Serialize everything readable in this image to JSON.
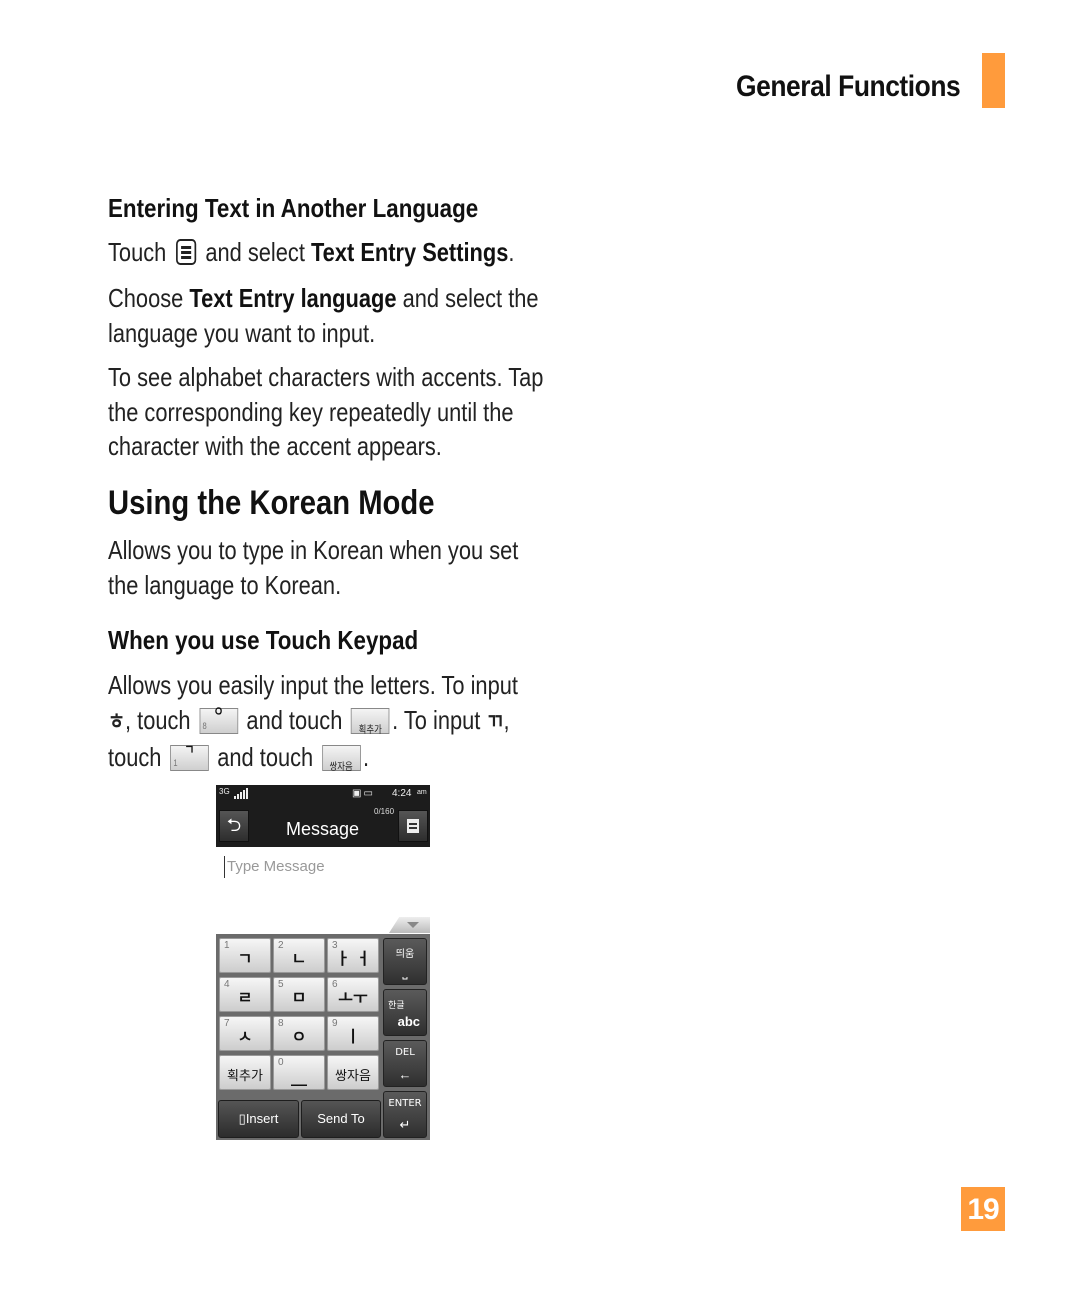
{
  "header": {
    "section_title": "General Functions",
    "accent_color": "#ff9b3c"
  },
  "entering_text": {
    "heading": "Entering Text in Another Language",
    "p1": {
      "before": "Touch",
      "icon": "menu-icon",
      "middle": "and select",
      "bold": "Text Entry Settings",
      "after": "."
    },
    "p2": {
      "before": "Choose",
      "bold": "Text Entry language",
      "after_line1": "and select the",
      "line2": "language you want to input."
    },
    "p3": {
      "line1": "To see alphabet characters with accents. Tap",
      "line2": "the corresponding key repeatedly until the",
      "line3": "character with the accent appears."
    }
  },
  "korean_mode": {
    "heading": "Using the Korean Mode",
    "intro_line1": "Allows you to type in Korean when you set",
    "intro_line2": "the language to Korean.",
    "subheading": "When you use Touch Keypad",
    "body_line1": "Allows you easily input the letters. To input",
    "char_h": "ㅎ",
    "touch_1": ", touch",
    "key_o": {
      "num": "8",
      "glyph": "ㅇ"
    },
    "and_touch": "and touch",
    "key_stroke": "획추가",
    "to_input": ". To input",
    "char_kk": "ㄲ",
    "comma": ",",
    "touch_2": "touch",
    "key_g": {
      "num": "1",
      "glyph": "ㄱ"
    },
    "and_touch_2": "and touch",
    "key_double": "쌍자음",
    "period": "."
  },
  "phone": {
    "status": {
      "network": "3G",
      "time": "4:24",
      "ampm": "am",
      "icons": "▣▭"
    },
    "title": "Message",
    "counter": "0/160",
    "placeholder": "Type Message",
    "keys": [
      {
        "num": "1",
        "glyph": "ㄱ"
      },
      {
        "num": "2",
        "glyph": "ㄴ"
      },
      {
        "num": "3",
        "glyph": "ㅏ ㅓ"
      },
      {
        "num": "4",
        "glyph": "ㄹ"
      },
      {
        "num": "5",
        "glyph": "ㅁ"
      },
      {
        "num": "6",
        "glyph": "ㅗㅜ"
      },
      {
        "num": "7",
        "glyph": "ㅅ"
      },
      {
        "num": "8",
        "glyph": "ㅇ"
      },
      {
        "num": "9",
        "glyph": "ㅣ"
      },
      {
        "num": "",
        "glyph": "획추가"
      },
      {
        "num": "0",
        "glyph": "__"
      },
      {
        "num": "",
        "glyph": "쌍자음"
      }
    ],
    "side_keys": {
      "space": {
        "label": "띄움",
        "glyph": "⎵"
      },
      "lang": {
        "label": "한글",
        "glyph": "abc"
      },
      "del": {
        "label": "DEL",
        "glyph": "←"
      },
      "enter": {
        "label": "ENTER",
        "glyph": "↵"
      }
    },
    "insert_label": "Insert",
    "send_to_label": "Send To"
  },
  "page_number": "19"
}
